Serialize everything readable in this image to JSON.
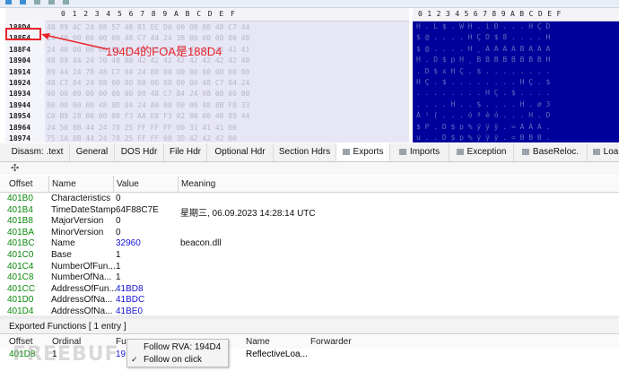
{
  "hex": {
    "columns": [
      "0",
      "1",
      "2",
      "3",
      "4",
      "5",
      "6",
      "7",
      "8",
      "9",
      "A",
      "B",
      "C",
      "D",
      "E",
      "F"
    ],
    "rows": [
      {
        "offset": "188D4",
        "bytes": "48 89 4C 24 08 57 48 81 EC D0 00 00 00 48 C7 44",
        "ascii": "H . L $ . W H . ì Ð . . . H Ç D"
      },
      {
        "offset": "188E4",
        "bytes": "24 40 00 00 00 00 48 C7 44 24 38 00 00 00 00 48",
        "ascii": "$ @ . . . . H Ç D $ 8 . . . . H"
      },
      {
        "offset": "188F4",
        "bytes": "24 40 00 00 00 00 48 B8 41 41 41 41 42 41 41 41",
        "ascii": "$ @ . . . . H ¸ A A A A B A A A"
      },
      {
        "offset": "18904",
        "bytes": "48 89 44 24 70 48 B8 42 42 42 42 42 42 42 42 48",
        "ascii": "H . D $ p H ¸ B B B B B B B B H"
      },
      {
        "offset": "18914",
        "bytes": "89 44 24 78 48 C7 84 24 80 00 00 00 00 00 00 00",
        "ascii": ". D $ x H Ç . $ . . . . . . . ."
      },
      {
        "offset": "18924",
        "bytes": "48 C7 84 24 88 00 00 00 00 00 00 00 48 C7 84 24",
        "ascii": "H Ç . $ . . . . . . . . H Ç . $"
      },
      {
        "offset": "18934",
        "bytes": "90 00 00 00 00 00 00 00 48 C7 84 24 98 00 00 00",
        "ascii": ". . . . . . . . H Ç . $ . . . ."
      },
      {
        "offset": "18944",
        "bytes": "00 00 00 00 48 8D 84 24 A0 00 00 00 48 8B F8 33",
        "ascii": ". . . . H . . $ . . . . H . ø 3"
      },
      {
        "offset": "18954",
        "bytes": "C0 B9 28 00 00 00 F3 AA E8 F3 02 00 00 48 89 44",
        "ascii": "À ¹ ( . . . ó ª è ó . . . H . D"
      },
      {
        "offset": "18964",
        "bytes": "24 50 8B 44 24 70 25 FF FF FF 00 31 41 41 00",
        "ascii": "$ P . D $ p % ÿ ÿ ÿ . = A A A ."
      },
      {
        "offset": "18974",
        "bytes": "75 1A 8B 44 24 70 25 FF FF 00 3D 42 42 42 00",
        "ascii": "u . . D $ p % ÿ ÿ ÿ . = B B B ."
      }
    ]
  },
  "annotation": {
    "text": "194D4的FOA是188D4"
  },
  "tabs": [
    {
      "label": "Disasm: .text",
      "icon": ""
    },
    {
      "label": "General",
      "icon": ""
    },
    {
      "label": "DOS Hdr",
      "icon": ""
    },
    {
      "label": "File Hdr",
      "icon": ""
    },
    {
      "label": "Optional Hdr",
      "icon": ""
    },
    {
      "label": "Section Hdrs",
      "icon": ""
    },
    {
      "label": "Exports",
      "icon": "folder-icon"
    },
    {
      "label": "Imports",
      "icon": "folder-icon"
    },
    {
      "label": "Exception",
      "icon": "folder-icon"
    },
    {
      "label": "BaseReloc.",
      "icon": "folder-icon"
    },
    {
      "label": "Loa",
      "icon": "folder-icon"
    }
  ],
  "exports_table": {
    "headers": [
      "Offset",
      "Name",
      "Value",
      "Meaning"
    ],
    "rows": [
      {
        "offset": "401B0",
        "name": "Characteristics",
        "value": "0",
        "meaning": "",
        "value_link": false
      },
      {
        "offset": "401B4",
        "name": "TimeDateStamp",
        "value": "64F88C7E",
        "meaning": "星期三, 06.09.2023 14:28:14 UTC",
        "value_link": false
      },
      {
        "offset": "401B8",
        "name": "MajorVersion",
        "value": "0",
        "meaning": "",
        "value_link": false
      },
      {
        "offset": "401BA",
        "name": "MinorVersion",
        "value": "0",
        "meaning": "",
        "value_link": false
      },
      {
        "offset": "401BC",
        "name": "Name",
        "value": "32960",
        "meaning": "beacon.dll",
        "value_link": true
      },
      {
        "offset": "401C0",
        "name": "Base",
        "value": "1",
        "meaning": "",
        "value_link": false
      },
      {
        "offset": "401C4",
        "name": "NumberOfFun...",
        "value": "1",
        "meaning": "",
        "value_link": false
      },
      {
        "offset": "401C8",
        "name": "NumberOfNa...",
        "value": "1",
        "meaning": "",
        "value_link": false
      },
      {
        "offset": "401CC",
        "name": "AddressOfFun...",
        "value": "41BD8",
        "meaning": "",
        "value_link": true
      },
      {
        "offset": "401D0",
        "name": "AddressOfNa...",
        "value": "41BDC",
        "meaning": "",
        "value_link": true
      },
      {
        "offset": "401D4",
        "name": "AddressOfNa...",
        "value": "41BE0",
        "meaning": "",
        "value_link": true
      }
    ]
  },
  "exported_functions": {
    "title": "Exported Functions   [ 1 entry ]",
    "headers": {
      "offset": "Offset",
      "ordinal": "Ordinal",
      "fu": "Fu",
      "name": "Name",
      "forwarder": "Forwarder"
    },
    "row": {
      "offset": "401D8",
      "ordinal": "1",
      "fu": "19",
      "name": "ReflectiveLoa...",
      "forwarder": ""
    }
  },
  "context_menu": {
    "items": [
      {
        "label": "Follow RVA: 194D4",
        "checked": false
      },
      {
        "label": "Follow on click",
        "checked": true
      }
    ]
  },
  "watermark": "FREEBUF",
  "colors": {
    "ascii_bg": "#00009A",
    "annotation": "#E8232A",
    "offset_green": "#0A8A0A",
    "link_blue": "#1515D8"
  }
}
